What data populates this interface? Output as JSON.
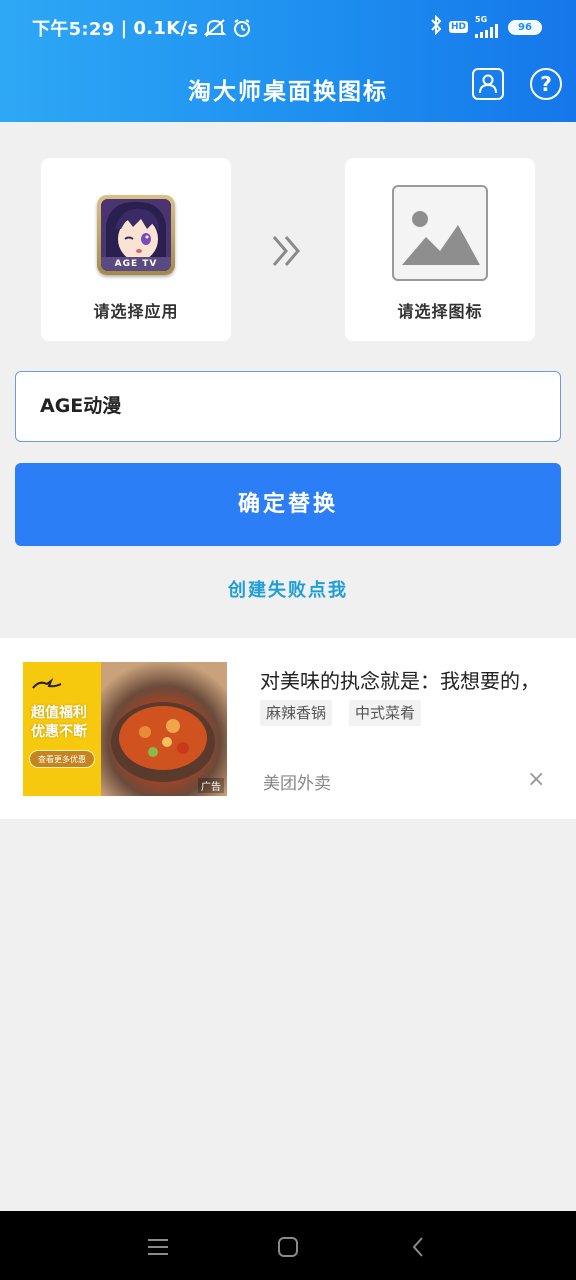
{
  "status_bar": {
    "time": "下午5:29",
    "speed": "0.1K/s",
    "hd": "HD",
    "network": "5G",
    "battery": "96"
  },
  "header": {
    "title": "淘大师桌面换图标",
    "user_icon": "user-icon",
    "help_icon": "help-icon",
    "help_glyph": "?"
  },
  "selector": {
    "app_label": "请选择应用",
    "app_thumb_text": "AGE TV",
    "icon_label": "请选择图标",
    "arrows_icon": "double-chevron-right-icon",
    "placeholder_icon": "image-placeholder-icon"
  },
  "name_field": {
    "value": "AGE动漫"
  },
  "confirm_button": {
    "label": "确定替换"
  },
  "fail_link": {
    "label": "创建失败点我"
  },
  "ad": {
    "slogan_line1": "超值福利",
    "slogan_line2": "优惠不断",
    "cta": "查看更多优惠",
    "tag": "广告",
    "title": "对美味的执念就是：我想要的，",
    "chips": [
      "麻辣香锅",
      "中式菜肴"
    ],
    "source": "美团外卖",
    "close_glyph": "×"
  },
  "nav_bar": {
    "menu_icon": "menu-icon",
    "home_icon": "home-icon",
    "back_icon": "back-icon"
  },
  "colors": {
    "header_start": "#2ea8f5",
    "header_end": "#1577ea",
    "primary": "#2b7ef5",
    "link": "#1e9ed8"
  }
}
